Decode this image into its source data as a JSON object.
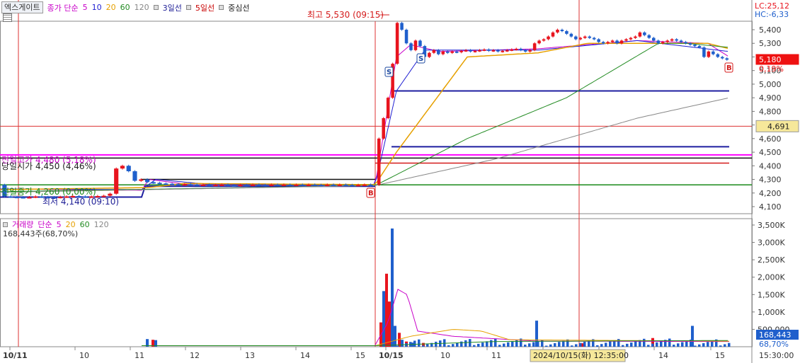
{
  "toolbar": {
    "symbol": "엑스게이트",
    "ma_title": "종가 단순",
    "ma_periods": [
      "5",
      "10",
      "20",
      "60",
      "120"
    ],
    "ma_colors": [
      "#c800c8",
      "#1e1ed2",
      "#e6a000",
      "#228b22",
      "#888888"
    ],
    "line3": "3일선",
    "line5": "5일선",
    "center_line": "중심선"
  },
  "volume_legend": {
    "title": "거래량",
    "ma_title": "단순",
    "periods": [
      "5",
      "20",
      "60",
      "120"
    ],
    "value": "168,443주(68,70%)"
  },
  "price_axis": {
    "ticks": [
      5400,
      5300,
      5200,
      5100,
      5000,
      4900,
      4800,
      4700,
      4600,
      4500,
      4400,
      4300,
      4200,
      4100
    ],
    "tick_labels": [
      "5,400",
      "5,300",
      "5,200",
      "5,100",
      "5,000",
      "4,900",
      "4,800",
      "4,700",
      "4,600",
      "4,500",
      "4,400",
      "4,300",
      "4,200",
      "4,100"
    ],
    "lc": "LC:25,12",
    "hc": "HC:-6,33",
    "current": "5,180",
    "change": "0,19%",
    "crosshair": "4,691"
  },
  "volume_axis": {
    "ticks": [
      500,
      1000,
      1500,
      2000,
      2500,
      3000,
      3500
    ],
    "tick_labels": [
      "500,000",
      "1,000K",
      "1,500K",
      "2,000K",
      "2,500K",
      "3,000K",
      "3,500K"
    ],
    "current": "168,443",
    "ratio": "68,70%"
  },
  "annotations": {
    "high": "최고 5,530 (09:15)",
    "low": "최저 4,140 (09:10)",
    "prev_high": "전일고가 4,480 (5,18%)",
    "upper_limit": "당일시가 4,450 (4,46%)",
    "prev_close": "전일종가 4,260 (0,00%)",
    "signal_s": "S",
    "signal_b": "B"
  },
  "time_axis": {
    "labels": [
      "10/11",
      "10",
      "11",
      "12",
      "13",
      "14",
      "15",
      "10/15",
      "10",
      "11",
      "12",
      "13",
      "14",
      "15"
    ],
    "crosshair": "2024/10/15(화) 12:35:00",
    "last": "15:30:00"
  },
  "chart_data": [
    {
      "type": "candlestick",
      "title": "엑스게이트",
      "ylim": [
        4080,
        5560
      ],
      "days": [
        "10/11",
        "10/15"
      ],
      "high": 5530,
      "low": 4140,
      "levels": {
        "prev_high": 4480,
        "open": 4450,
        "prev_close": 4260,
        "crosshair": 4691,
        "current": 5180
      },
      "day1_close": [
        4175,
        4172,
        4170,
        4168,
        4170,
        4175,
        4172,
        4170,
        4168,
        4172,
        4175,
        4178,
        4175,
        4172,
        4175,
        4178,
        4180,
        4195,
        4380,
        4400,
        4360,
        4290,
        4300,
        4280,
        4275,
        4270,
        4268,
        4265,
        4262,
        4265,
        4262,
        4260,
        4262,
        4258,
        4260,
        4262,
        4258,
        4255,
        4260,
        4258,
        4262,
        4260,
        4258,
        4262,
        4260,
        4262,
        4258,
        4262,
        4260,
        4262,
        4260,
        4258,
        4262,
        4260,
        4262,
        4260,
        4258,
        4260,
        4262,
        4255
      ],
      "day2_close": [
        4600,
        4750,
        4900,
        5150,
        5450,
        5400,
        5300,
        5250,
        5320,
        5280,
        5200,
        5230,
        5250,
        5220,
        5240,
        5230,
        5240,
        5235,
        5245,
        5250,
        5240,
        5245,
        5250,
        5255,
        5245,
        5250,
        5240,
        5245,
        5250,
        5255,
        5260,
        5250,
        5240,
        5250,
        5300,
        5320,
        5330,
        5350,
        5380,
        5400,
        5390,
        5370,
        5350,
        5330,
        5340,
        5350,
        5340,
        5330,
        5310,
        5300,
        5310,
        5320,
        5300,
        5320,
        5330,
        5340,
        5350,
        5380,
        5360,
        5340,
        5320,
        5300,
        5310,
        5320,
        5330,
        5320,
        5310,
        5300,
        5290,
        5280,
        5270,
        5200,
        5240,
        5220,
        5200,
        5190,
        5180
      ]
    },
    {
      "type": "bar",
      "title": "거래량",
      "ylabel": "",
      "ylim": [
        0,
        3600000
      ],
      "current": 168443,
      "max": 3400000
    }
  ]
}
